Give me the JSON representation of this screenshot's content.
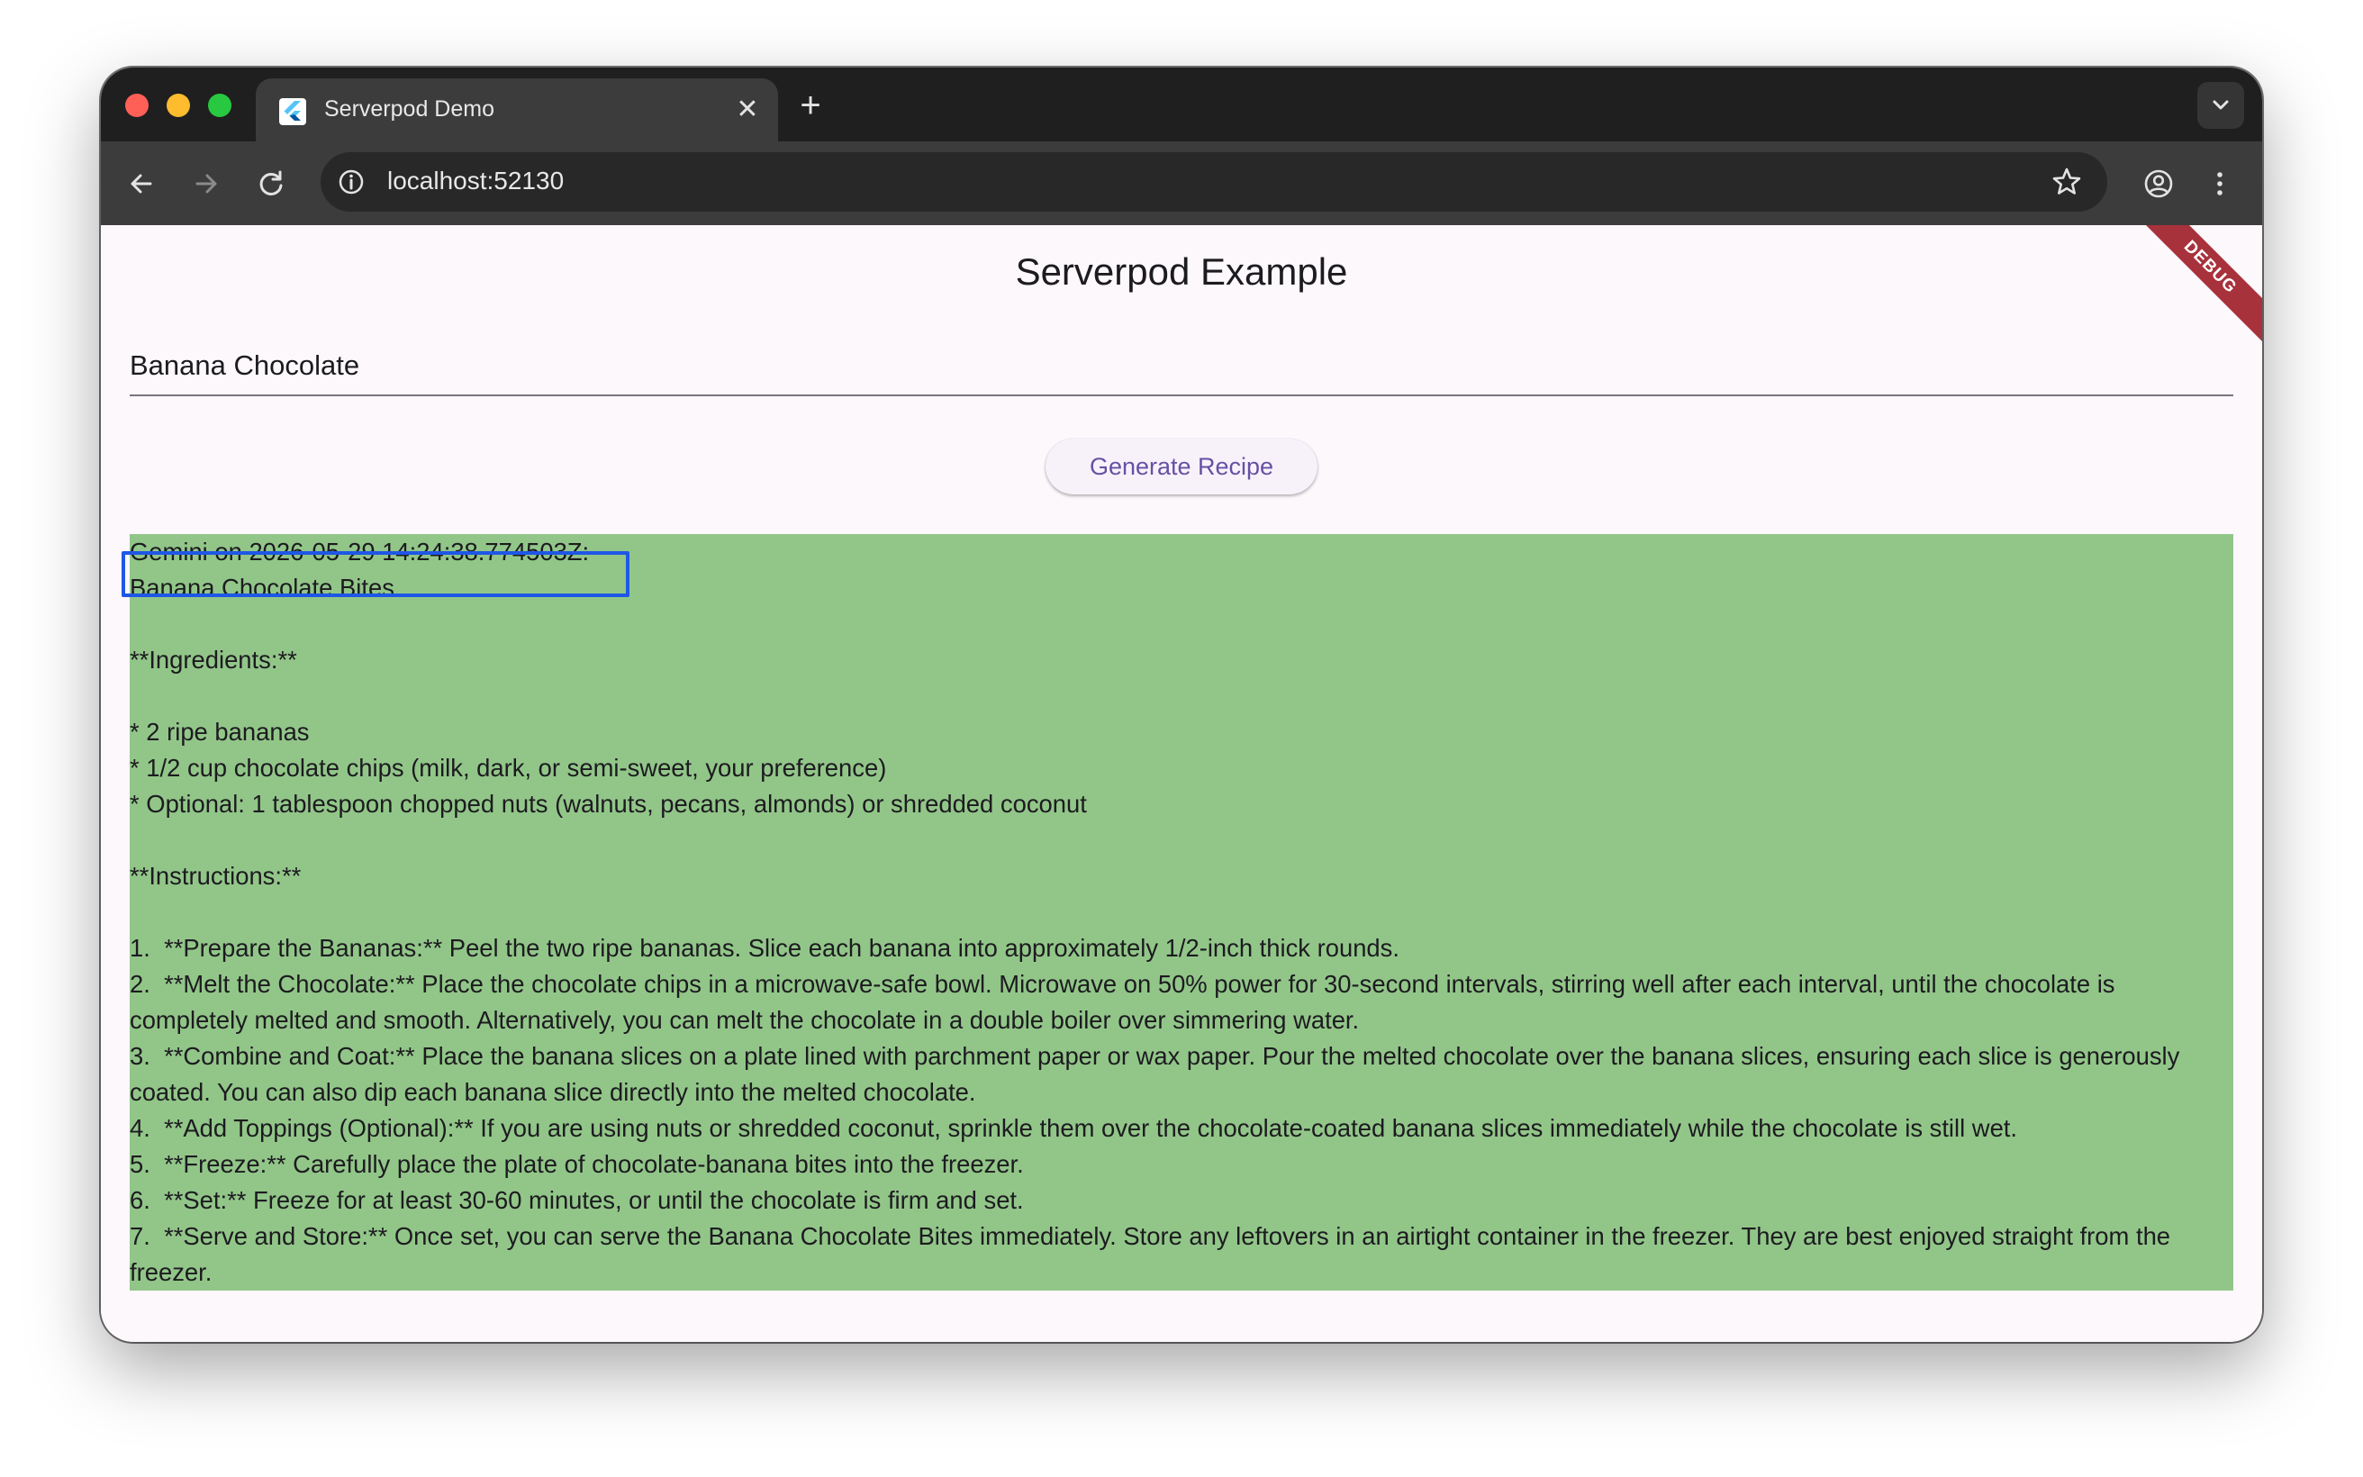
{
  "browser": {
    "tab_title": "Serverpod Demo",
    "tab_close": "✕",
    "new_tab": "+",
    "url": "localhost:52130"
  },
  "app": {
    "title": "Serverpod Example",
    "debug_banner": "DEBUG",
    "input_value": "Banana Chocolate",
    "generate_button": "Generate Recipe"
  },
  "result": {
    "background_color": "#92c689",
    "header": "Gemini on 2026-05-29 14:24:38.774503Z:",
    "lines": [
      "Banana Chocolate Bites",
      "",
      "**Ingredients:**",
      "",
      "* 2 ripe bananas",
      "* 1/2 cup chocolate chips (milk, dark, or semi-sweet, your preference)",
      "* Optional: 1 tablespoon chopped nuts (walnuts, pecans, almonds) or shredded coconut",
      "",
      "**Instructions:**",
      "",
      "1.  **Prepare the Bananas:** Peel the two ripe bananas. Slice each banana into approximately 1/2-inch thick rounds.",
      "2.  **Melt the Chocolate:** Place the chocolate chips in a microwave-safe bowl. Microwave on 50% power for 30-second intervals, stirring well after each interval, until the chocolate is completely melted and smooth. Alternatively, you can melt the chocolate in a double boiler over simmering water.",
      "3.  **Combine and Coat:** Place the banana slices on a plate lined with parchment paper or wax paper. Pour the melted chocolate over the banana slices, ensuring each slice is generously coated. You can also dip each banana slice directly into the melted chocolate.",
      "4.  **Add Toppings (Optional):** If you are using nuts or shredded coconut, sprinkle them over the chocolate-coated banana slices immediately while the chocolate is still wet.",
      "5.  **Freeze:** Carefully place the plate of chocolate-banana bites into the freezer.",
      "6.  **Set:** Freeze for at least 30-60 minutes, or until the chocolate is firm and set.",
      "7.  **Serve and Store:** Once set, you can serve the Banana Chocolate Bites immediately. Store any leftovers in an airtight container in the freezer. They are best enjoyed straight from the freezer."
    ]
  },
  "icons": {
    "traffic_lights": [
      "close-dot",
      "minimize-dot",
      "zoom-dot"
    ],
    "toolbar": [
      "back-arrow-icon",
      "forward-arrow-icon",
      "reload-icon",
      "info-icon",
      "star-icon",
      "profile-icon",
      "kebab-menu-icon"
    ]
  }
}
